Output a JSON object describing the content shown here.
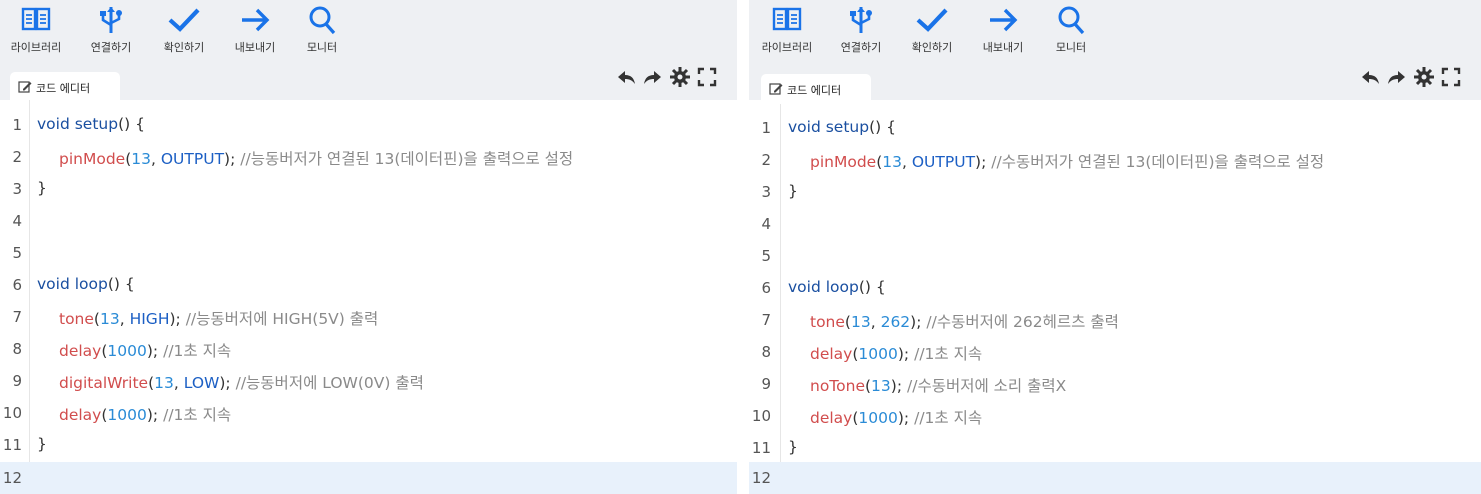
{
  "toolbar": {
    "library": "라이브러리",
    "connect": "연결하기",
    "verify": "확인하기",
    "export": "내보내기",
    "monitor": "모니터"
  },
  "tab_label": "코드 에디터",
  "colors": {
    "icon_blue": "#1a73e8",
    "topbar_bg": "#eef0f3",
    "active_line": "#e8f1fb"
  },
  "icons": [
    "book-icon",
    "usb-icon",
    "check-icon",
    "arrow-right-icon",
    "search-icon",
    "undo-icon",
    "redo-icon",
    "gear-icon",
    "fullscreen-icon",
    "edit-icon"
  ],
  "left": {
    "line_numbers": [
      "1",
      "2",
      "3",
      "4",
      "5",
      "6",
      "7",
      "8",
      "9",
      "10",
      "11",
      "12"
    ],
    "setup_head": {
      "a": "void ",
      "b": "setup",
      "c": "() {"
    },
    "l2": {
      "fn": "pinMode",
      "open": "(",
      "n": "13",
      ",": ", ",
      "c": "OUTPUT",
      "close": ");",
      "cm": "//능동버저가 연결된 13(데이터핀)을 출력으로 설정"
    },
    "close1": "}",
    "loop_head": {
      "a": "void ",
      "b": "loop",
      "c": "() {"
    },
    "l7": {
      "fn": "tone",
      "open": "(",
      "n": "13",
      ",": ", ",
      "c": "HIGH",
      "close": ");",
      "cm": "//능동버저에 HIGH(5V) 출력"
    },
    "l8": {
      "fn": "delay",
      "open": "(",
      "n": "1000",
      "close": ");",
      "cm": "//1초 지속"
    },
    "l9": {
      "fn": "digitalWrite",
      "open": "(",
      "n": "13",
      ",": ", ",
      "c": "LOW",
      "close": ");",
      "cm": "//능동버저에 LOW(0V) 출력"
    },
    "l10": {
      "fn": "delay",
      "open": "(",
      "n": "1000",
      "close": ");",
      "cm": "//1초 지속"
    },
    "close2": "}"
  },
  "right": {
    "line_numbers": [
      "1",
      "2",
      "3",
      "4",
      "5",
      "6",
      "7",
      "8",
      "9",
      "10",
      "11",
      "12"
    ],
    "setup_head": {
      "a": "void ",
      "b": "setup",
      "c": "() {"
    },
    "l2": {
      "fn": "pinMode",
      "open": "(",
      "n": "13",
      ",": ", ",
      "c": "OUTPUT",
      "close": ");",
      "cm": "//수동버저가 연결된 13(데이터핀)을 출력으로 설정"
    },
    "close1": "}",
    "loop_head": {
      "a": "void ",
      "b": "loop",
      "c": "() {"
    },
    "l7": {
      "fn": "tone",
      "open": "(",
      "n": "13",
      ",": ", ",
      "n2": "262",
      "close": ");",
      "cm": "//수동버저에 262헤르츠 출력"
    },
    "l8": {
      "fn": "delay",
      "open": "(",
      "n": "1000",
      "close": ");",
      "cm": "//1초 지속"
    },
    "l9": {
      "fn": "noTone",
      "open": "(",
      "n": "13",
      "close": ");",
      "cm": "//수동버저에 소리 출력X"
    },
    "l10": {
      "fn": "delay",
      "open": "(",
      "n": "1000",
      "close": ");",
      "cm": "//1초 지속"
    },
    "close2": "}"
  }
}
